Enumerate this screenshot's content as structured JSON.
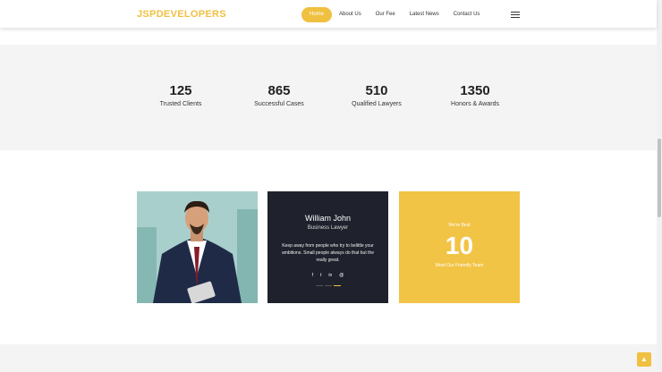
{
  "header": {
    "brand": "JSPDEVELOPERS",
    "nav": [
      "Home",
      "About Us",
      "Our Fee",
      "Latest News",
      "Contact Us"
    ],
    "menu_icon": "hamburger-icon"
  },
  "stats": [
    {
      "value": "125",
      "label": "Trusted Clients"
    },
    {
      "value": "865",
      "label": "Successful Cases"
    },
    {
      "value": "510",
      "label": "Qualified Lawyers"
    },
    {
      "value": "1350",
      "label": "Honors & Awards"
    }
  ],
  "profile": {
    "name": "William John",
    "role": "Business Lawyer",
    "description": "Keep away from people who try to belittle your ambitions. Small people always do that but the really great.",
    "social": [
      "f",
      "t",
      "in",
      "@"
    ]
  },
  "team_count": {
    "top": "We're Best",
    "number": "10",
    "bottom": "Meet Our Friendly Team"
  },
  "colors": {
    "accent": "#f0c040",
    "dark_card": "#1f222c"
  }
}
